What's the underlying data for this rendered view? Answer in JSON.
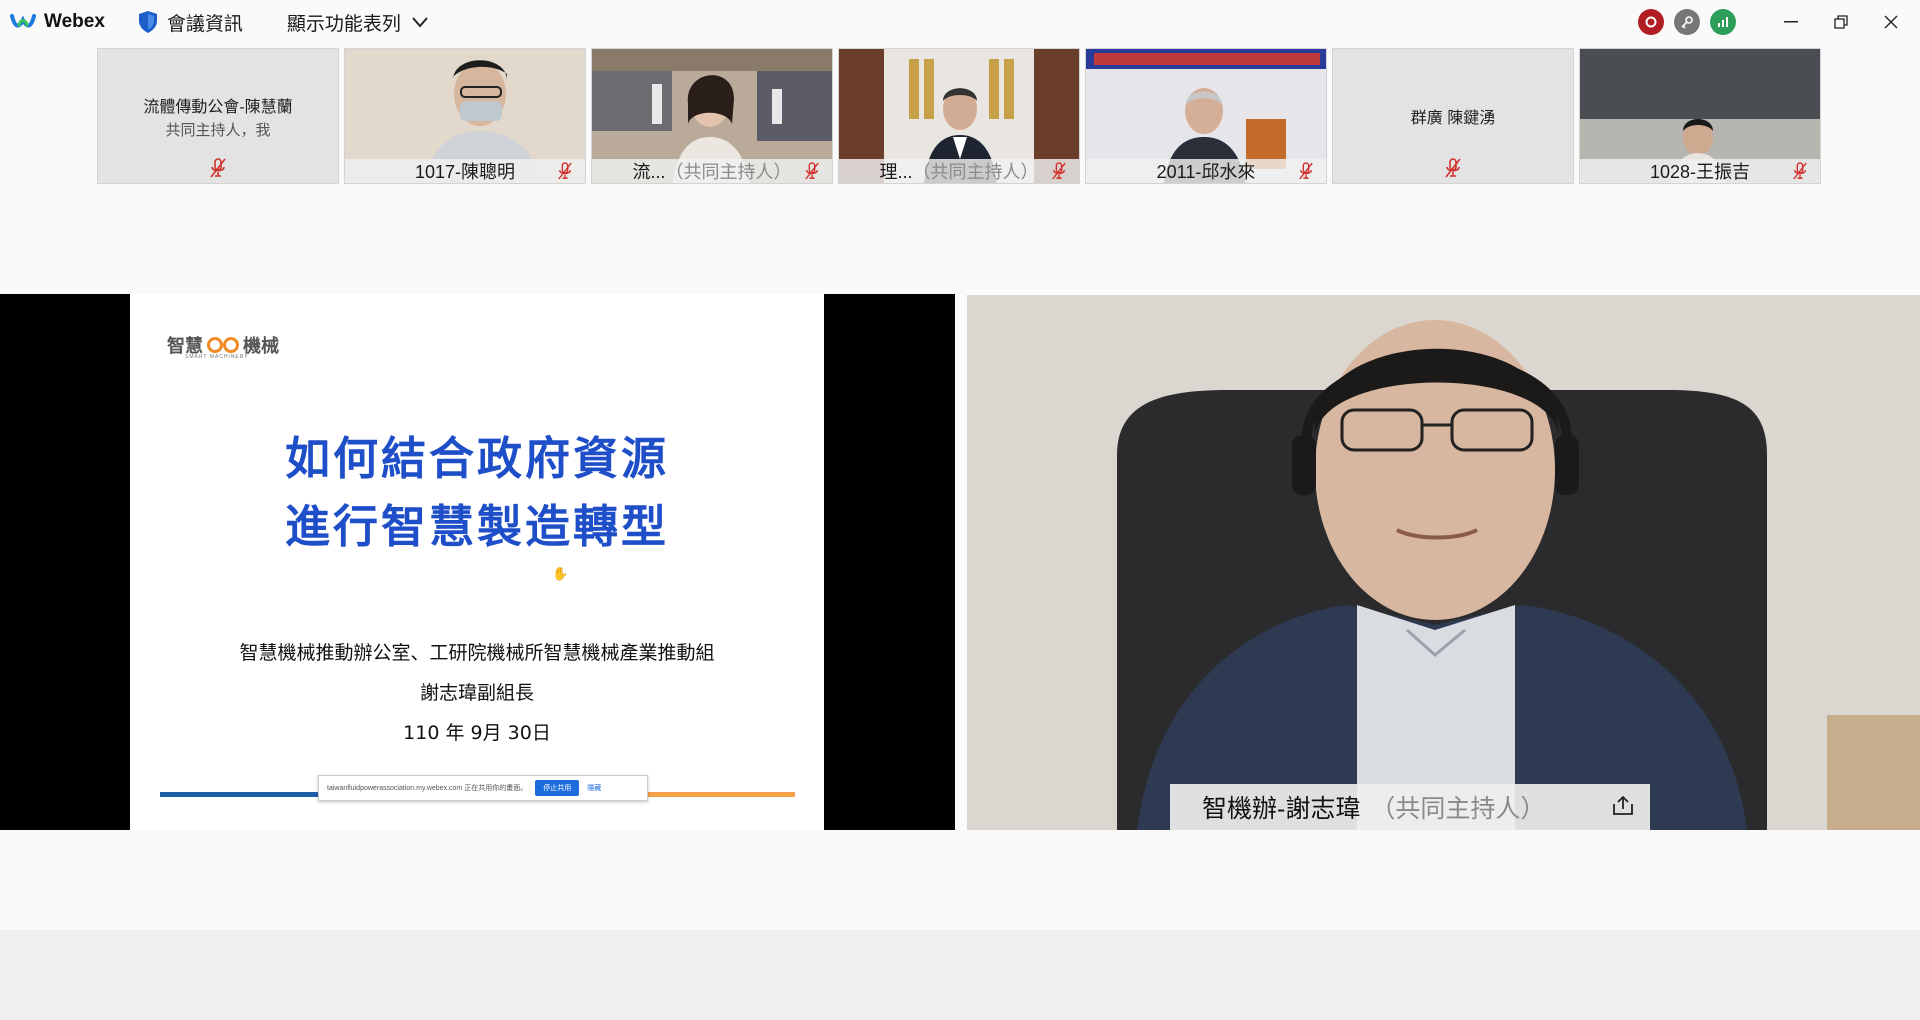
{
  "titlebar": {
    "app_name": "Webex",
    "meeting_info_label": "會議資訊",
    "view_menu_label": "顯示功能表列"
  },
  "filmstrip": [
    {
      "type": "name",
      "name": "流體傳動公會-陳慧蘭",
      "role": "共同主持人，我",
      "muted": true
    },
    {
      "type": "video",
      "label": "1017-陳聰明",
      "cohost": "",
      "muted": true
    },
    {
      "type": "video",
      "label": "流...",
      "cohost": "（共同主持人）",
      "muted": true
    },
    {
      "type": "video",
      "label": "理...",
      "cohost": "（共同主持人）",
      "muted": true
    },
    {
      "type": "video",
      "label": "2011-邱水來",
      "cohost": "",
      "muted": true
    },
    {
      "type": "name",
      "name": "群廣 陳鍵湧",
      "role": "",
      "muted": true
    },
    {
      "type": "video",
      "label": "1028-王振吉",
      "cohost": "",
      "muted": true
    }
  ],
  "slide": {
    "logo_text_left": "智慧",
    "logo_text_right": "機械",
    "logo_small": "SMART MACHINERY",
    "title_line1": "如何結合政府資源",
    "title_line2": "進行智慧製造轉型",
    "org_line": "智慧機械推動辦公室、工研院機械所智慧機械產業推動組",
    "presenter_line": "謝志瑋副組長",
    "date_line": "110 年 9月 30日",
    "share_notice_text": "taiwanfluidpowerassociation.my.webex.com 正在共用你的畫面。",
    "stop_share_label": "停止共用",
    "hide_label": "隱藏"
  },
  "speaker": {
    "name": "智機辦-謝志瑋",
    "role": "（共同主持人）"
  },
  "colors": {
    "slide_title": "#1f4fc8",
    "rec_red": "#c0392b",
    "status_green": "#2e9e5b"
  }
}
